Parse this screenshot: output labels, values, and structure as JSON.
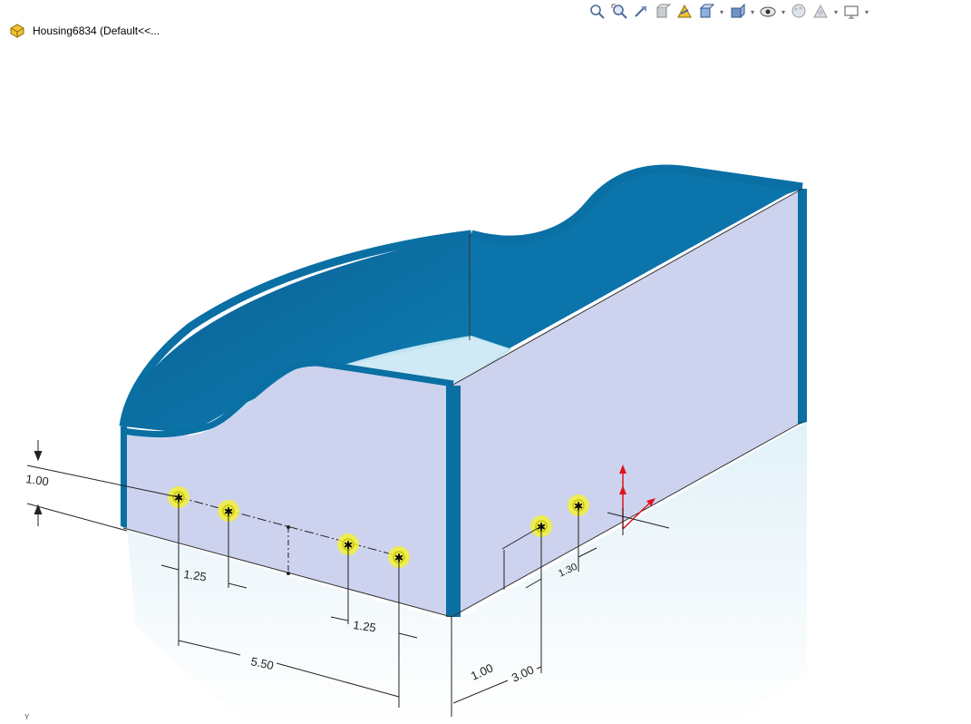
{
  "window": {
    "document_title": "Housing6834  (Default<<...",
    "part_icon": "part-icon"
  },
  "toolbar": [
    {
      "name": "zoom-to-fit-icon",
      "dropdown": false
    },
    {
      "name": "zoom-to-area-icon",
      "dropdown": false
    },
    {
      "name": "previous-view-icon",
      "dropdown": false
    },
    {
      "name": "section-view-icon",
      "dropdown": false
    },
    {
      "name": "dynamic-annotation-views-icon",
      "dropdown": false
    },
    {
      "name": "view-orientation-icon",
      "dropdown": true
    },
    {
      "name": "display-style-icon",
      "dropdown": true
    },
    {
      "name": "hide-show-items-icon",
      "dropdown": true
    },
    {
      "name": "edit-appearance-icon",
      "dropdown": false
    },
    {
      "name": "apply-scene-icon",
      "dropdown": true
    },
    {
      "name": "view-settings-icon",
      "dropdown": true
    }
  ],
  "dimensions": {
    "height_offset": "1.00",
    "hole_spacing_left": "1.25",
    "hole_spacing_right": "1.25",
    "hole_span": "5.50",
    "side_vertical": "1.00",
    "side_horizontal": "3.00",
    "side_spacing": "1.30"
  },
  "colors": {
    "housing_blue": "#0a6fa3",
    "face_lavender": "#cdd3ee",
    "hole_highlight": "#f2f03a",
    "origin_red": "#e0141e"
  },
  "axis_indicator": "Y"
}
